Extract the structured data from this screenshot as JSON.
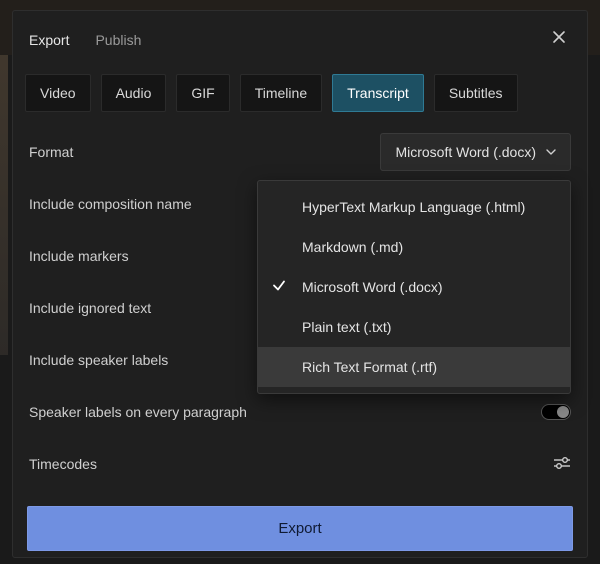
{
  "header": {
    "tabs": [
      "Export",
      "Publish"
    ],
    "active": 0
  },
  "tabs": {
    "items": [
      "Video",
      "Audio",
      "GIF",
      "Timeline",
      "Transcript",
      "Subtitles"
    ],
    "active": 4
  },
  "format": {
    "label": "Format",
    "selected": "Microsoft Word (.docx)",
    "options": [
      "HyperText Markup Language (.html)",
      "Markdown (.md)",
      "Microsoft Word (.docx)",
      "Plain text (.txt)",
      "Rich Text Format (.rtf)"
    ],
    "selected_index": 2,
    "hover_index": 4
  },
  "options": {
    "include_composition_name": "Include composition name",
    "include_markers": "Include markers",
    "include_ignored_text": "Include ignored text",
    "include_speaker_labels": "Include speaker labels",
    "speaker_labels_every_paragraph": "Speaker labels on every paragraph",
    "timecodes": "Timecodes"
  },
  "footer": {
    "export_label": "Export"
  }
}
